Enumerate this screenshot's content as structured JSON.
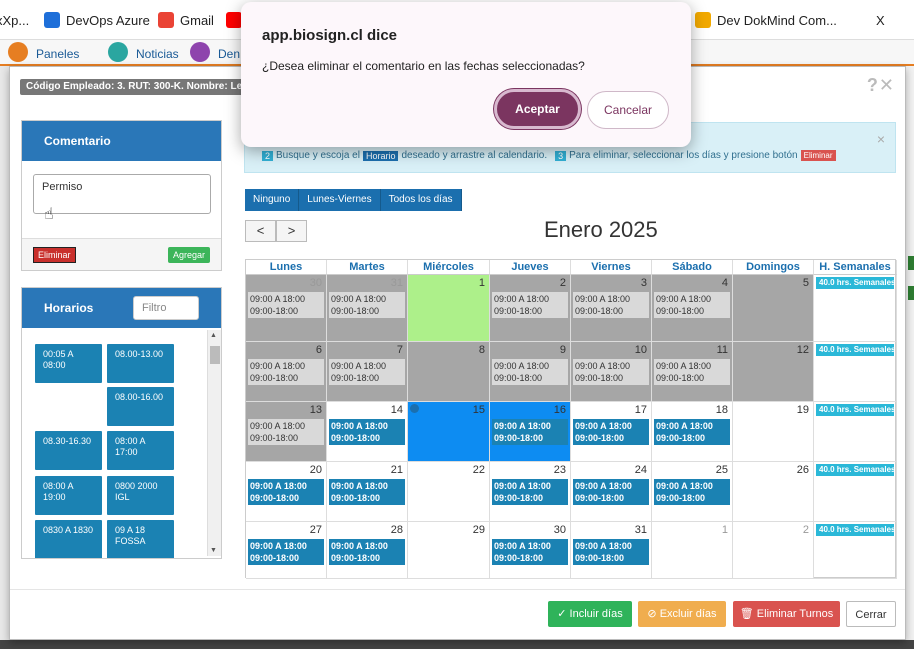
{
  "browser": {
    "bookmarks": [
      {
        "label": "xXp...",
        "icon": "bookmark-icon",
        "color": "#888888"
      },
      {
        "label": "DevOps Azure",
        "icon": "azure-devops-icon",
        "color": "#1e6fd9"
      },
      {
        "label": "Gmail",
        "icon": "google-icon",
        "color": "#ea4335"
      },
      {
        "label": "",
        "icon": "youtube-icon",
        "color": "#ff0000"
      },
      {
        "label": "Dev DokMind Com...",
        "icon": "dokmind-icon",
        "color": "#f2a900"
      },
      {
        "label": "X",
        "icon": "bookmark-icon",
        "color": "#333333"
      }
    ]
  },
  "appbar": {
    "items": [
      {
        "label": "Paneles",
        "icon": "panels-icon",
        "color": "#e67e22"
      },
      {
        "label": "Noticias",
        "icon": "news-icon",
        "color": "#2aa6a0"
      },
      {
        "label": "Den",
        "icon": "user-icon",
        "color": "#8e44ad"
      }
    ]
  },
  "modal": {
    "employee_label": "Código Empleado: 3. RUT: 300-K. Nombre: Le",
    "header_icons": "?✕",
    "comentario": {
      "title": "Comentario",
      "text": "Permiso",
      "delete_label": "Eliminar",
      "add_label": "Agregar"
    },
    "horarios": {
      "title": "Horarios",
      "filter_placeholder": "Filtro",
      "slots": [
        "00:05 A 08:00",
        "08.00-13.00",
        "08.00-16.00",
        "08.30-16.30",
        "08:00 A 17:00",
        "08:00 A 19:00",
        "0800 2000 IGL",
        "0830 A 1830",
        "09 A 18 FOSSA"
      ]
    },
    "info": {
      "step2": "2",
      "text_a": "Busque y escoja el",
      "horario_tag": "Horario",
      "text_b": "deseado y arrastre al calendario.",
      "step3": "3",
      "text_c": "Para eliminar, seleccionar los días y presione botón",
      "eliminar_tag": "Eliminar",
      "close": "×"
    },
    "filters": [
      "Ninguno",
      "Lunes-Viernes",
      "Todos los días"
    ],
    "nav": {
      "prev": "<",
      "next": ">"
    },
    "calendar": {
      "title": "Enero 2025",
      "headers": [
        "Lunes",
        "Martes",
        "Miércoles",
        "Jueves",
        "Viernes",
        "Sábado",
        "Domingos",
        "H. Semanales"
      ],
      "weekly_label": "40.0 hrs. Semanales",
      "weeks": [
        [
          {
            "d": "30",
            "dim": true,
            "bg": "#a6a6a6",
            "ev": "grey",
            "l1": "09:00 A 18:00",
            "l2": "09:00-18:00"
          },
          {
            "d": "31",
            "dim": true,
            "bg": "#a6a6a6",
            "ev": "grey",
            "l1": "09:00 A 18:00",
            "l2": "09:00-18:00"
          },
          {
            "d": "1",
            "bg": "#adf08a"
          },
          {
            "d": "2",
            "bg": "#a6a6a6",
            "ev": "grey",
            "l1": "09:00 A 18:00",
            "l2": "09:00-18:00"
          },
          {
            "d": "3",
            "bg": "#a6a6a6",
            "ev": "grey",
            "l1": "09:00 A 18:00",
            "l2": "09:00-18:00"
          },
          {
            "d": "4",
            "bg": "#a6a6a6",
            "ev": "grey",
            "l1": "09:00 A 18:00",
            "l2": "09:00-18:00"
          },
          {
            "d": "5",
            "bg": "#a6a6a6"
          }
        ],
        [
          {
            "d": "6",
            "bg": "#a6a6a6",
            "ev": "grey",
            "l1": "09:00 A 18:00",
            "l2": "09:00-18:00"
          },
          {
            "d": "7",
            "bg": "#a6a6a6",
            "ev": "grey",
            "l1": "09:00 A 18:00",
            "l2": "09:00-18:00"
          },
          {
            "d": "8",
            "bg": "#a6a6a6"
          },
          {
            "d": "9",
            "bg": "#a6a6a6",
            "ev": "grey",
            "l1": "09:00 A 18:00",
            "l2": "09:00-18:00"
          },
          {
            "d": "10",
            "bg": "#a6a6a6",
            "ev": "grey",
            "l1": "09:00 A 18:00",
            "l2": "09:00-18:00"
          },
          {
            "d": "11",
            "bg": "#a6a6a6",
            "ev": "grey",
            "l1": "09:00 A 18:00",
            "l2": "09:00-18:00"
          },
          {
            "d": "12",
            "bg": "#a6a6a6"
          }
        ],
        [
          {
            "d": "13",
            "bg": "#a6a6a6",
            "ev": "grey",
            "l1": "09:00 A 18:00",
            "l2": "09:00-18:00"
          },
          {
            "d": "14",
            "bg": "#ffffff",
            "ev": "blue",
            "l1": "09:00 A 18:00",
            "l2": "09:00-18:00"
          },
          {
            "d": "15",
            "bg": "#0d8cf2",
            "info": true
          },
          {
            "d": "16",
            "bg": "#0d8cf2",
            "ev": "blue",
            "l1": "09:00 A 18:00",
            "l2": "09:00-18:00"
          },
          {
            "d": "17",
            "bg": "#ffffff",
            "ev": "blue",
            "l1": "09:00 A 18:00",
            "l2": "09:00-18:00"
          },
          {
            "d": "18",
            "bg": "#ffffff",
            "ev": "blue",
            "l1": "09:00 A 18:00",
            "l2": "09:00-18:00"
          },
          {
            "d": "19",
            "bg": "#ffffff"
          }
        ],
        [
          {
            "d": "20",
            "bg": "#ffffff",
            "ev": "blue",
            "l1": "09:00 A 18:00",
            "l2": "09:00-18:00"
          },
          {
            "d": "21",
            "bg": "#ffffff",
            "ev": "blue",
            "l1": "09:00 A 18:00",
            "l2": "09:00-18:00"
          },
          {
            "d": "22",
            "bg": "#ffffff"
          },
          {
            "d": "23",
            "bg": "#ffffff",
            "ev": "blue",
            "l1": "09:00 A 18:00",
            "l2": "09:00-18:00"
          },
          {
            "d": "24",
            "bg": "#ffffff",
            "ev": "blue",
            "l1": "09:00 A 18:00",
            "l2": "09:00-18:00"
          },
          {
            "d": "25",
            "bg": "#ffffff",
            "ev": "blue",
            "l1": "09:00 A 18:00",
            "l2": "09:00-18:00"
          },
          {
            "d": "26",
            "bg": "#ffffff"
          }
        ],
        [
          {
            "d": "27",
            "bg": "#ffffff",
            "ev": "blue",
            "l1": "09:00 A 18:00",
            "l2": "09:00-18:00"
          },
          {
            "d": "28",
            "bg": "#ffffff",
            "ev": "blue",
            "l1": "09:00 A 18:00",
            "l2": "09:00-18:00"
          },
          {
            "d": "29",
            "bg": "#ffffff"
          },
          {
            "d": "30",
            "bg": "#ffffff",
            "ev": "blue",
            "l1": "09:00 A 18:00",
            "l2": "09:00-18:00"
          },
          {
            "d": "31",
            "bg": "#ffffff",
            "ev": "blue",
            "l1": "09:00 A 18:00",
            "l2": "09:00-18:00"
          },
          {
            "d": "1",
            "dim": true,
            "bg": "#ffffff"
          },
          {
            "d": "2",
            "dim": true,
            "bg": "#ffffff"
          }
        ]
      ]
    },
    "footer": [
      {
        "label": "✓ Incluir días",
        "color": "#2fb35a"
      },
      {
        "label": "⊘ Excluir días",
        "color": "#f0ad4e"
      },
      {
        "label": "🗑 Eliminar Turnos",
        "color": "#d9534f"
      },
      {
        "label": "Cerrar",
        "color": "#ffffff"
      }
    ]
  },
  "dialog": {
    "title": "app.biosign.cl dice",
    "message": "¿Desea eliminar el comentario en las fechas seleccionadas?",
    "accept": "Aceptar",
    "cancel": "Cancelar"
  }
}
